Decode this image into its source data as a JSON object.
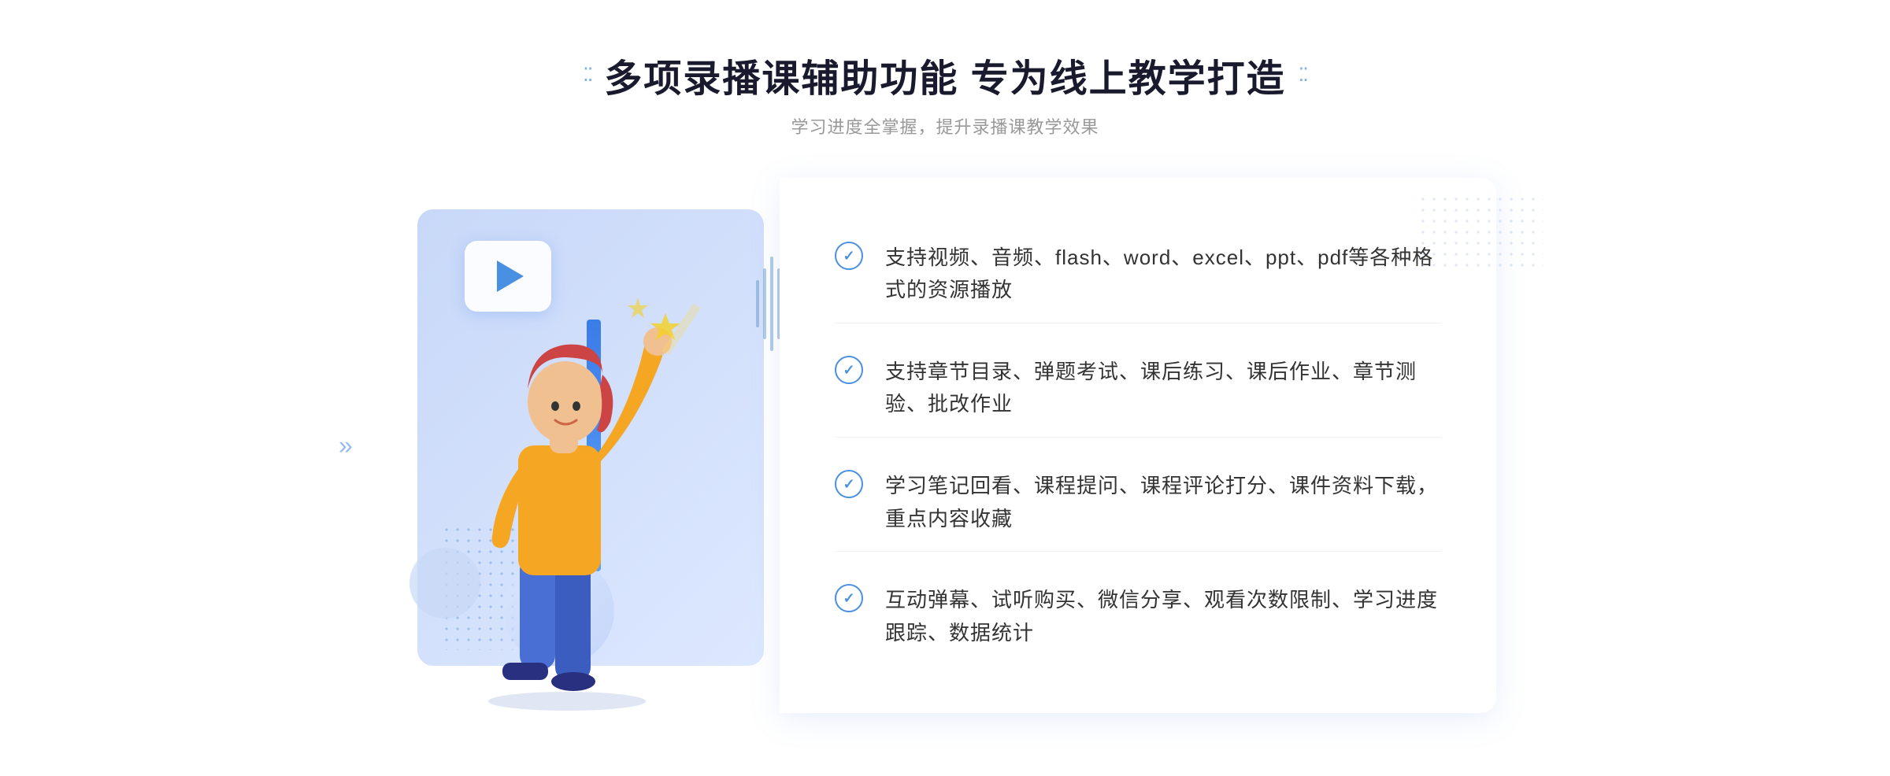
{
  "header": {
    "title": "多项录播课辅助功能 专为线上教学打造",
    "subtitle": "学习进度全掌握，提升录播课教学效果",
    "dots_left": "⁚⁚",
    "dots_right": "⁚⁚"
  },
  "features": [
    {
      "id": 1,
      "text": "支持视频、音频、flash、word、excel、ppt、pdf等各种格式的资源播放"
    },
    {
      "id": 2,
      "text": "支持章节目录、弹题考试、课后练习、课后作业、章节测验、批改作业"
    },
    {
      "id": 3,
      "text": "学习笔记回看、课程提问、课程评论打分、课件资料下载，重点内容收藏"
    },
    {
      "id": 4,
      "text": "互动弹幕、试听购买、微信分享、观看次数限制、学习进度跟踪、数据统计"
    }
  ],
  "colors": {
    "accent": "#4a90e2",
    "title": "#1a1a2e",
    "subtitle": "#999999",
    "text": "#333333",
    "bg_light": "#f5f8ff"
  },
  "icons": {
    "check": "✓",
    "play": "▶",
    "chevron": "»"
  }
}
